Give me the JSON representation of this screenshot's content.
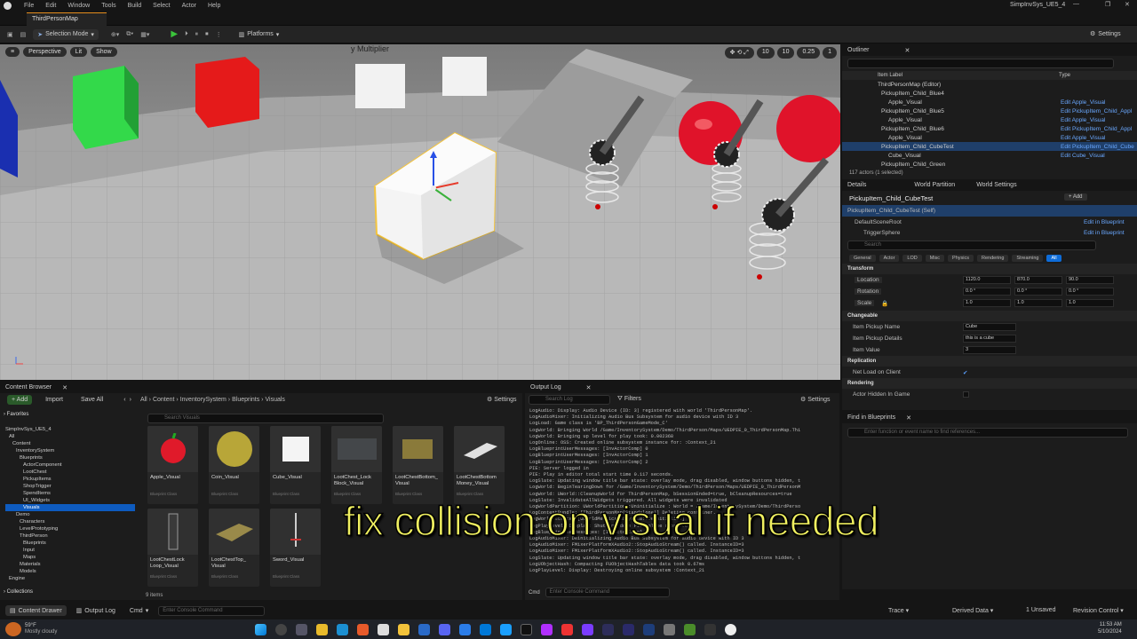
{
  "menu": [
    "File",
    "Edit",
    "Window",
    "Tools",
    "Build",
    "Select",
    "Actor",
    "Help"
  ],
  "project_name": "SimpInvSys_UE5_4",
  "level_tab": "ThirdPersonMap",
  "toolbar": {
    "mode": "Selection Mode",
    "platforms": "Platforms",
    "settings": "Settings"
  },
  "viewport": {
    "perspective": "Perspective",
    "lit": "Lit",
    "show": "Show",
    "multiplier_text": "y Multiplier",
    "snap_grid": "10",
    "snap_rot": "10",
    "snap_scale": "0.25",
    "cam_speed": "1"
  },
  "outliner": {
    "title": "Outliner",
    "col_label": "Item Label",
    "col_type": "Type",
    "rows": [
      {
        "label": "ThirdPersonMap (Editor)",
        "type": ""
      },
      {
        "label": "PickupItem_Child_Blue4",
        "type": ""
      },
      {
        "label": "Apple_Visual",
        "type": "Edit Apple_Visual"
      },
      {
        "label": "PickupItem_Child_Blue5",
        "type": "Edit PickupItem_Child_Appl"
      },
      {
        "label": "Apple_Visual",
        "type": "Edit Apple_Visual"
      },
      {
        "label": "PickupItem_Child_Blue6",
        "type": "Edit PickupItem_Child_Appl"
      },
      {
        "label": "Apple_Visual",
        "type": "Edit Apple_Visual"
      },
      {
        "label": "PickupItem_Child_CubeTest",
        "type": "Edit PickupItem_Child_Cube"
      },
      {
        "label": "Cube_Visual",
        "type": "Edit Cube_Visual"
      },
      {
        "label": "PickupItem_Child_Green",
        "type": ""
      }
    ],
    "count": "117 actors (1 selected)"
  },
  "details": {
    "tabs": [
      "Details",
      "World Partition",
      "World Settings"
    ],
    "actor_name": "PickupItem_Child_CubeTest",
    "add": "+ Add",
    "components": [
      "PickupItem_Child_CubeTest (Self)",
      "DefaultSceneRoot",
      "TriggerSphere"
    ],
    "edit_bp": "Edit in Blueprint",
    "search_placeholder": "Search",
    "filters": [
      "General",
      "Actor",
      "LOD",
      "Misc",
      "Physics",
      "Rendering",
      "Streaming",
      "All"
    ],
    "transform": "Transform",
    "location": {
      "label": "Location",
      "x": "1120.0",
      "y": "870.0",
      "z": "90.0"
    },
    "rotation": {
      "label": "Rotation",
      "x": "0.0 °",
      "y": "0.0 °",
      "z": "0.0 °"
    },
    "scale": {
      "label": "Scale",
      "x": "1.0",
      "y": "1.0",
      "z": "1.0"
    },
    "changeable": "Changeable",
    "pickup_name": {
      "label": "Item Pickup Name",
      "value": "Cube"
    },
    "pickup_details": {
      "label": "Item Pickup Details",
      "value": "this is a cube"
    },
    "item_value": {
      "label": "Item Value",
      "value": "3"
    },
    "replication": "Replication",
    "net_load": "Net Load on Client",
    "rendering": "Rendering",
    "hidden": "Actor Hidden In Game"
  },
  "find": {
    "title": "Find in Blueprints",
    "placeholder": "Enter function or event name to find references..."
  },
  "content_browser": {
    "title": "Content Browser",
    "add": "+ Add",
    "import": "Import",
    "save_all": "Save All",
    "settings": "Settings",
    "path": [
      "All",
      "Content",
      "InventorySystem",
      "Blueprints",
      "Visuals"
    ],
    "favorites": "Favorites",
    "search_placeholder": "Search Visuals",
    "collections": "Collections",
    "item_count": "9 items",
    "tree": [
      "SimpInvSys_UE5_4",
      "All",
      "Content",
      "InventorySystem",
      "Blueprints",
      "ActorComponent",
      "LootChest",
      "PickupItems",
      "ShopTrigger",
      "SpendItems",
      "UI_Widgets",
      "Visuals",
      "Demo",
      "Characters",
      "LevelPrototyping",
      "ThirdPerson",
      "Blueprints",
      "Input",
      "Maps",
      "Materials",
      "Models",
      "Engine"
    ],
    "assets": [
      {
        "name": "Apple_Visual",
        "cls": "Blueprint Class"
      },
      {
        "name": "Coin_Visual",
        "cls": "Blueprint Class"
      },
      {
        "name": "Cube_Visual",
        "cls": "Blueprint Class"
      },
      {
        "name": "LootChest_Lock Block_Visual",
        "cls": "Blueprint Class"
      },
      {
        "name": "LootChestBottom_ Visual",
        "cls": "Blueprint Class"
      },
      {
        "name": "LootChestBottom Money_Visual",
        "cls": "Blueprint Class"
      },
      {
        "name": "LootChestLock Loop_Visual",
        "cls": "Blueprint Class"
      },
      {
        "name": "LootChestTop_ Visual",
        "cls": "Blueprint Class"
      },
      {
        "name": "Sword_Visual",
        "cls": "Blueprint Class"
      }
    ]
  },
  "output_log": {
    "title": "Output Log",
    "search_placeholder": "Search Log",
    "filters": "Filters",
    "settings": "Settings",
    "cmd": "Cmd",
    "console_placeholder": "Enter Console Command",
    "lines": [
      "LogAudio: Display: Audio Device (ID: 3) registered with world 'ThirdPersonMap'.",
      "LogAudioMixer: Initializing Audio Bus Subsystem for audio device with ID 3",
      "LogLoad: Game class is 'BP_ThirdPersonGameMode_C'",
      "LogWorld: Bringing World /Game/InventorySystem/Demo/ThirdPerson/Maps/UEDPIE_0_ThirdPersonMap.Thi",
      "LogWorld: Bringing up level for play took: 0.002368",
      "LogOnline: OSS: Created online subsystem instance for: :Context_21",
      "LogBlueprintUserMessages: [InvActorComp] 0",
      "LogBlueprintUserMessages: [InvActorComp] 1",
      "LogBlueprintUserMessages: [InvActorComp] 2",
      "PIE: Server logged in",
      "PIE: Play in editor total start time 0.117 seconds.",
      "LogSlate: Updating window title bar state: overlay mode, drag disabled, window buttons hidden, t",
      "LogWorld: BeginTearingDown for /Game/InventorySystem/Demo/ThirdPerson/Maps/UEDPIE_0_ThirdPersonM",
      "LogWorld: UWorld::CleanupWorld for ThirdPersonMap, bSessionEnded=true, bCleanupResources=true",
      "LogSlate: InvalidateAllWidgets triggered.  All widgets were invalidated",
      "LogWorldPartition: UWorldPartition::Uninitialize : World = /Game/InventorySystem/Demo/ThirdPerso",
      "LogContentBundle: [ThirdPersonMap(Standalone)] Deleting container.",
      "LogWorldMetrics: [UWorldMetricsSubsystem::Deinitialize]",
      "LogPlayLevel: Display: Shutting down PIE online subsystems",
      "LogBlueprintUserMessages: [InvActorComp] 3",
      "LogAudioMixer: Deinitializing Audio Bus Subsystem for audio device with ID 3",
      "LogAudioMixer: FMixerPlatformXAudio2::StopAudioStream() called. InstanceID=3",
      "LogAudioMixer: FMixerPlatformXAudio2::StopAudioStream() called. InstanceID=3",
      "LogSlate: Updating window title bar state: overlay mode, drag disabled, window buttons hidden, t",
      "LogUObjectHash: Compacting FUObjectHashTables data took   0.67ms",
      "LogPlayLevel: Display: Destroying online subsystem :Context_21"
    ]
  },
  "status": {
    "drawer": "Content Drawer",
    "output": "Output Log",
    "cmd": "Cmd",
    "console_placeholder": "Enter Console Command",
    "trace": "Trace",
    "derived": "Derived Data",
    "unsaved": "1 Unsaved",
    "revision": "Revision Control"
  },
  "caption": "fix collision on visual if needed",
  "taskbar": {
    "temp": "59°F",
    "weather": "Mostly cloudy",
    "time": "11:53 AM",
    "date": "5/10/2024"
  }
}
